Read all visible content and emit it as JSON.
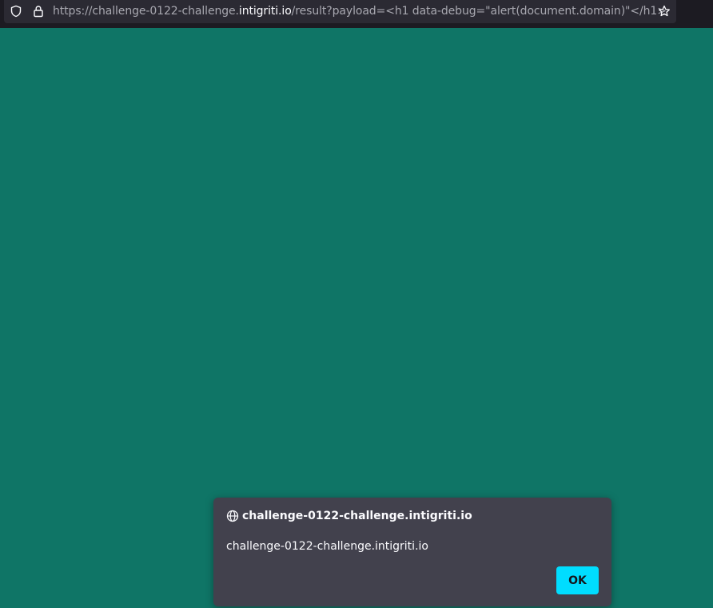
{
  "browser": {
    "url": {
      "prefix": "https://challenge-0122-challenge.",
      "host": "intigriti.io",
      "suffix": "/result?payload=<h1 data-debug=\"alert(document.domain)\"</h1>"
    },
    "icons": {
      "tracking": "shield-icon",
      "security": "lock-icon",
      "bookmark": "star-icon"
    }
  },
  "page": {
    "background": "#0f7566"
  },
  "alert_dialog": {
    "title": "challenge-0122-challenge.intigriti.io",
    "message": "challenge-0122-challenge.intigriti.io",
    "ok_label": "OK",
    "title_icon": "globe-icon",
    "accent": "#00ddff"
  }
}
